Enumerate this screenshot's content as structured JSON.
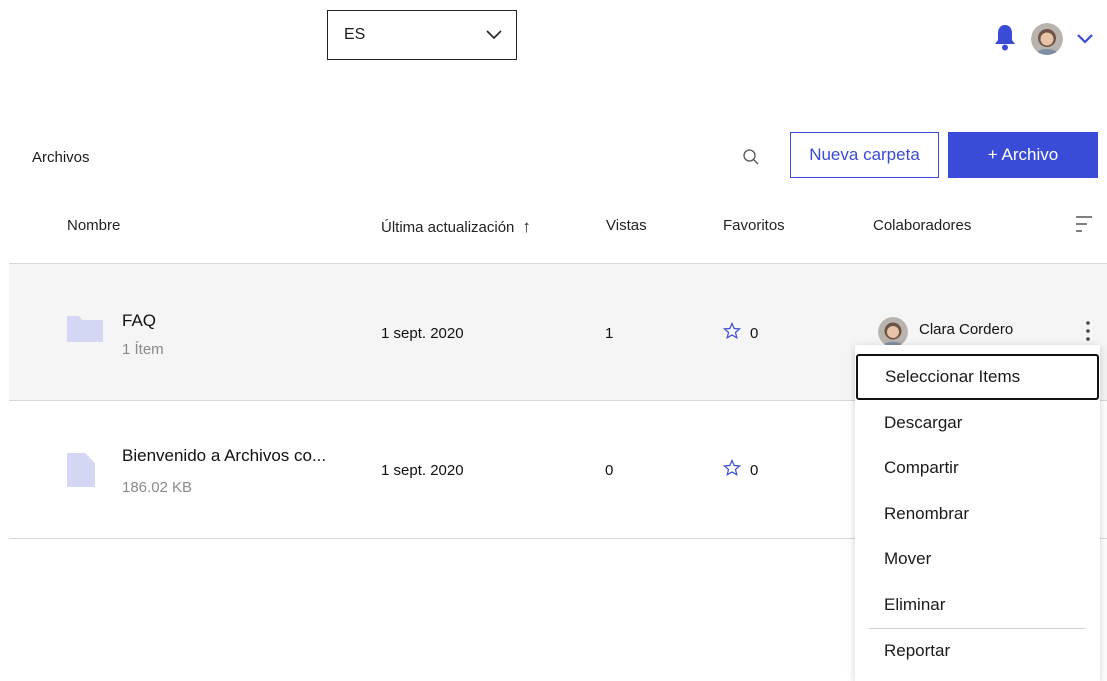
{
  "top": {
    "language_value": "ES"
  },
  "header": {
    "title": "Archivos",
    "new_folder_label": "Nueva carpeta",
    "add_file_label": "+ Archivo"
  },
  "columns": {
    "name": "Nombre",
    "updated": "Última actualización",
    "sort_arrow": "↑",
    "views": "Vistas",
    "favorites": "Favoritos",
    "collaborators": "Colaboradores"
  },
  "rows": [
    {
      "name": "FAQ",
      "sub": "1 Ítem",
      "updated": "1 sept. 2020",
      "views": "1",
      "favorites": "0",
      "collaborator": "Clara Cordero",
      "type_icon": "folder-icon"
    },
    {
      "name": "Bienvenido a Archivos co...",
      "sub": "186.02 KB",
      "updated": "1 sept. 2020",
      "views": "0",
      "favorites": "0",
      "collaborator": "",
      "type_icon": "file-icon"
    }
  ],
  "menu": {
    "items": [
      "Seleccionar Items",
      "Descargar",
      "Compartir",
      "Renombrar",
      "Mover",
      "Eliminar",
      "Reportar"
    ]
  },
  "colors": {
    "accent": "#3a4bd8",
    "icon_fill": "#d3d7f3"
  }
}
